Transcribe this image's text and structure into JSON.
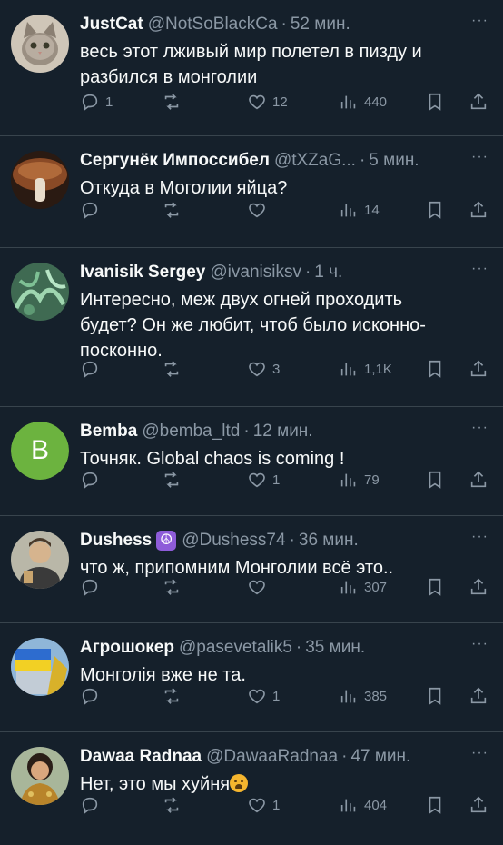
{
  "tweets": [
    {
      "name": "JustCat",
      "handle": "@NotSoBlackCa",
      "sep": "·",
      "time": "52 мин.",
      "text": "весь этот лживый мир полетел в пизду и разбился в монголии",
      "replies": "1",
      "retweets": "",
      "likes": "12",
      "views": "440",
      "avatar": "cat-avatar"
    },
    {
      "name": "Сергунёк Импоссибел",
      "handle": "@tXZaG...",
      "sep": "·",
      "time": "5 мин.",
      "text": "Откуда в Моголии яйца?",
      "replies": "",
      "retweets": "",
      "likes": "",
      "views": "14",
      "avatar": "mushroom-avatar"
    },
    {
      "name": "Ivanisik Sergey",
      "handle": "@ivanisiksv",
      "sep": "·",
      "time": "1 ч.",
      "text": "Интересно, меж двух огней проходить будет? Он же любит, чтоб было исконно-посконно.",
      "replies": "",
      "retweets": "",
      "likes": "3",
      "views": "1,1K",
      "avatar": "plant-avatar"
    },
    {
      "name": "Bemba",
      "handle": "@bemba_ltd",
      "sep": "·",
      "time": "12 мин.",
      "text": "Точняк. Global chaos is coming !",
      "replies": "",
      "retweets": "",
      "likes": "1",
      "views": "79",
      "avatar_letter": "B"
    },
    {
      "name": "Dushess",
      "badge": "☮",
      "handle": "@Dushess74",
      "sep": "·",
      "time": "36 мин.",
      "text": "что ж, припомним Монголии всё это..",
      "replies": "",
      "retweets": "",
      "likes": "",
      "views": "307",
      "avatar": "person-avatar"
    },
    {
      "name": "Агрошокер",
      "handle": "@pasevetalik5",
      "sep": "·",
      "time": "35 мин.",
      "text": "Монголія вже не та.",
      "replies": "",
      "retweets": "",
      "likes": "1",
      "views": "385",
      "avatar": "flag-avatar"
    },
    {
      "name": "Dawaa Radnaa",
      "handle": "@DawaaRadnaa",
      "sep": "·",
      "time": "47 мин.",
      "text": "Нет, это мы хуйня",
      "replies": "",
      "retweets": "",
      "likes": "1",
      "views": "404",
      "avatar": "woman-avatar"
    }
  ],
  "colors": {
    "background": "#15202b",
    "text": "#f7f9f9",
    "muted": "#8b98a5",
    "divider": "#38444d",
    "bemba_avatar": "#6cb33f"
  },
  "icons": [
    "reply-icon",
    "retweet-icon",
    "like-icon",
    "views-icon",
    "bookmark-icon",
    "share-icon",
    "more-icon"
  ],
  "more_label": "···"
}
